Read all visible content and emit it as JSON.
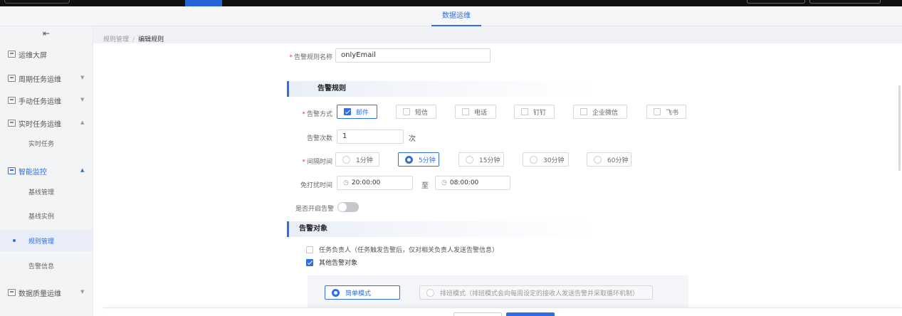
{
  "top_nav": {
    "active_tab": "数据运维"
  },
  "sidebar": {
    "collapse_icon": "collapse-icon",
    "items": [
      {
        "label": "运维大屏",
        "icon": "monitor-icon"
      },
      {
        "label": "周期任务运维",
        "icon": "grid-icon",
        "arrow": "▼"
      },
      {
        "label": "手动任务运维",
        "icon": "grid-icon",
        "arrow": "▼"
      },
      {
        "label": "实时任务运维",
        "icon": "grid-icon",
        "arrow": "▲"
      },
      {
        "label": "智能监控",
        "icon": "monitor-icon",
        "arrow": "▲",
        "active": true
      },
      {
        "label": "数据质量运维",
        "icon": "grid-icon",
        "arrow": "▼"
      }
    ],
    "realtime_sub": [
      "实时任务"
    ],
    "smart_sub": [
      "基线管理",
      "基线实例",
      "规则管理",
      "告警信息"
    ],
    "selected_sub": "规则管理"
  },
  "breadcrumb": {
    "parent": "规则管理",
    "separator": "/",
    "current": "编辑规则"
  },
  "form": {
    "rule_name": {
      "label": "告警规则名称",
      "value": "onlyEmail"
    },
    "section_rule": "告警规则",
    "alert_method": {
      "label": "告警方式",
      "options": [
        {
          "label": "邮件",
          "checked": true
        },
        {
          "label": "短信",
          "checked": false
        },
        {
          "label": "电话",
          "checked": false
        },
        {
          "label": "钉钉",
          "checked": false
        },
        {
          "label": "企业微信",
          "checked": false
        },
        {
          "label": "飞书",
          "checked": false
        }
      ]
    },
    "alert_count": {
      "label": "告警次数",
      "value": "1",
      "unit": "次"
    },
    "interval": {
      "label": "间隔时间",
      "options": [
        {
          "label": "1分钟",
          "selected": false
        },
        {
          "label": "5分钟",
          "selected": true
        },
        {
          "label": "15分钟",
          "selected": false
        },
        {
          "label": "30分钟",
          "selected": false
        },
        {
          "label": "60分钟",
          "selected": false
        }
      ]
    },
    "dnd_time": {
      "label": "免打扰时间",
      "start": "20:00:00",
      "to": "至",
      "end": "08:00:00"
    },
    "enable_alert": {
      "label": "是否开启告警",
      "on": false
    },
    "section_target": "告警对象",
    "targets": [
      {
        "label": "任务负责人（任务触发告警后，仅对相关负责人发送告警信息）",
        "checked": false
      },
      {
        "label": "其他告警对象",
        "checked": true
      }
    ],
    "mode": {
      "options": [
        {
          "label": "简单模式",
          "selected": true
        },
        {
          "label": "排班模式（排班模式会向每周设定的接收人发送告警并采取循环机制）",
          "selected": false
        }
      ]
    }
  },
  "colors": {
    "accent": "#2f6fe0",
    "required": "#e4393c",
    "topbar": "#111111"
  }
}
